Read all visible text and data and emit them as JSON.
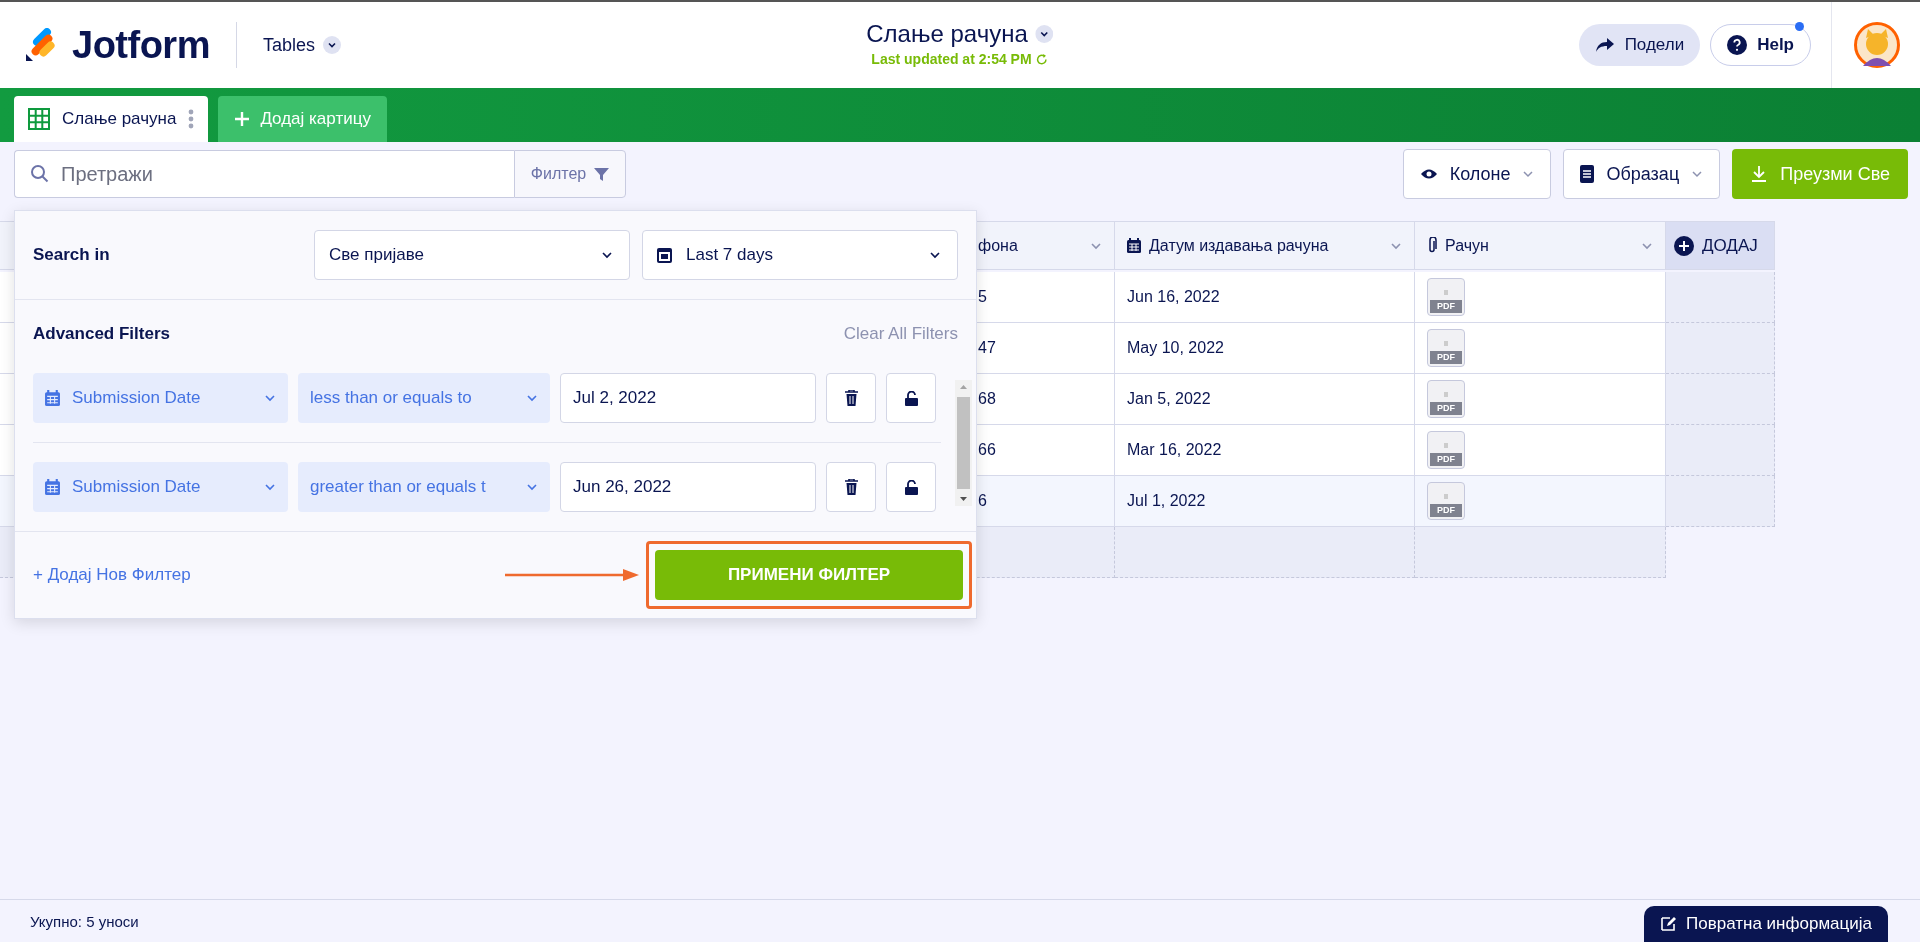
{
  "header": {
    "logo": "Jotform",
    "product": "Tables",
    "title": "Слање рачуна",
    "last_updated": "Last updated at 2:54 PM",
    "share": "Подели",
    "help": "Help",
    "help_notification": true
  },
  "tabs": [
    {
      "label": "Слање рачуна",
      "selected": true
    }
  ],
  "add_tab": "Додај картицу",
  "toolbar": {
    "search": {
      "placeholder": "Претражи"
    },
    "filter": "Филтер",
    "buttons": [
      {
        "kind": "columns",
        "label": "Колоне"
      },
      {
        "kind": "form",
        "label": "Образац"
      },
      {
        "kind": "download",
        "label": "Преузми Све"
      }
    ]
  },
  "filter_panel": {
    "search_in": "Search in",
    "scope": "Све пријаве",
    "range": "Last 7 days",
    "advanced": "Advanced Filters",
    "clear": "Clear All Filters",
    "filters": [
      {
        "field": "Submission Date",
        "operator": "less than or equals to",
        "value": "Jul 2, 2022"
      },
      {
        "field": "Submission Date",
        "operator": "greater than or equals t",
        "value": "Jun 26, 2022"
      }
    ],
    "add": "+ Додај Нов Филтер",
    "apply": "ПРИМЕНИ ФИЛТЕР",
    "apply_highlighted": true
  },
  "table": {
    "columns": [
      {
        "kind": "text",
        "label": "фона"
      },
      {
        "kind": "date",
        "label": "Датум издавања рачуна"
      },
      {
        "kind": "file",
        "label": "Рачун"
      }
    ],
    "add_column": "ДОДАЈ",
    "rows": [
      {
        "cells": [
          "5",
          "Jun 16, 2022",
          "PDF"
        ],
        "highlighted": false
      },
      {
        "cells": [
          "47",
          "May 10, 2022",
          "PDF"
        ],
        "highlighted": false
      },
      {
        "cells": [
          "68",
          "Jan 5, 2022",
          "PDF"
        ],
        "highlighted": false
      },
      {
        "cells": [
          "66",
          "Mar 16, 2022",
          "PDF"
        ],
        "highlighted": false
      },
      {
        "cells": [
          "6",
          "Jul 1, 2022",
          "PDF"
        ],
        "highlighted": true
      }
    ]
  },
  "status_bar": {
    "total": "Укупно: 5 уноси",
    "feedback": "Повратна информација"
  }
}
